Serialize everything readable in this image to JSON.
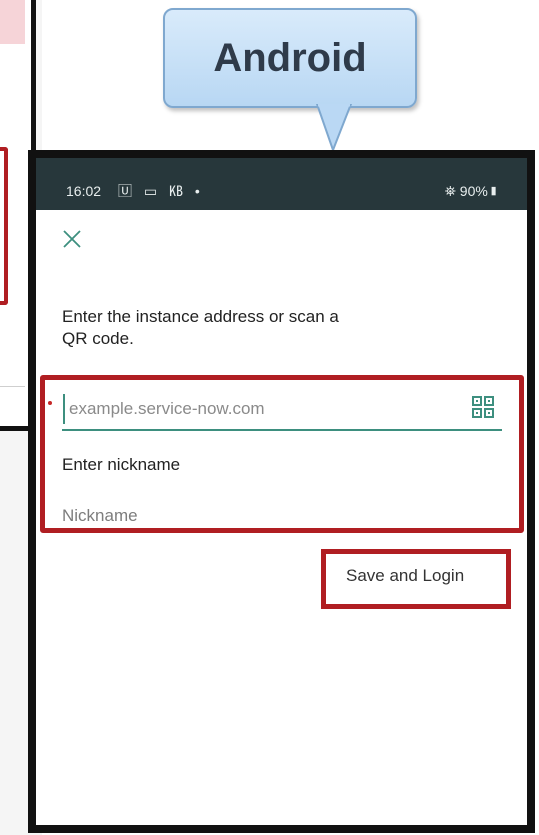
{
  "callout": {
    "label": "Android"
  },
  "status_bar": {
    "time": "16:02",
    "left_icons": "🅄 ▭ ㎅ •",
    "battery": "⛯ 90%▮"
  },
  "form": {
    "prompt": "Enter the instance address or scan a QR code.",
    "instance_placeholder": "example.service-now.com",
    "nickname_label": "Enter nickname",
    "nickname_placeholder": "Nickname",
    "save_label": "Save and Login"
  },
  "colors": {
    "accent": "#3d8f7f",
    "highlight": "#b01e22",
    "status_bg": "#27373b",
    "callout_bg": "#c8e1f7"
  }
}
